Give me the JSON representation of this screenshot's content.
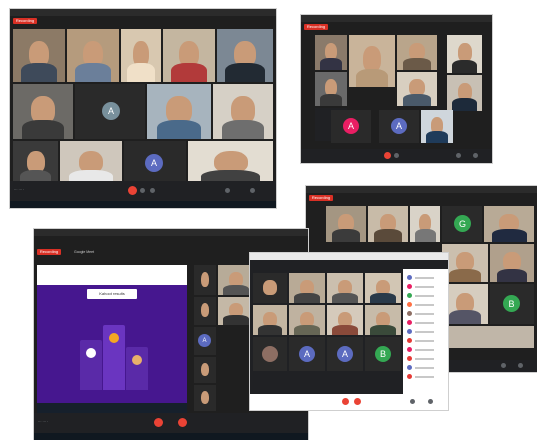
{
  "shots": [
    {
      "id": "a",
      "rec": "Recording",
      "tiles": 12,
      "avatars": [
        "A",
        "A"
      ]
    },
    {
      "id": "b",
      "rec": "Recording",
      "avatars": [
        "A",
        "A"
      ]
    },
    {
      "id": "c",
      "rec": "Recording",
      "title": "Google Meet",
      "quiz_title": "Kahoot results",
      "avatars": [
        "A"
      ]
    },
    {
      "id": "d",
      "rec": "Recording",
      "avatars": [
        "G",
        "B"
      ]
    },
    {
      "id": "e",
      "avatars": [
        "A",
        "A",
        "B"
      ]
    }
  ],
  "colors": {
    "meet_bg": "#202124",
    "end_call": "#ea4335",
    "avatar_blue": "#5c6bc0",
    "avatar_green": "#34a853",
    "avatar_pink": "#e91e63",
    "kahoot_purple": "#46178f"
  },
  "icons": [
    "end-call-icon",
    "mic-icon",
    "camera-icon",
    "people-icon",
    "chat-icon"
  ]
}
